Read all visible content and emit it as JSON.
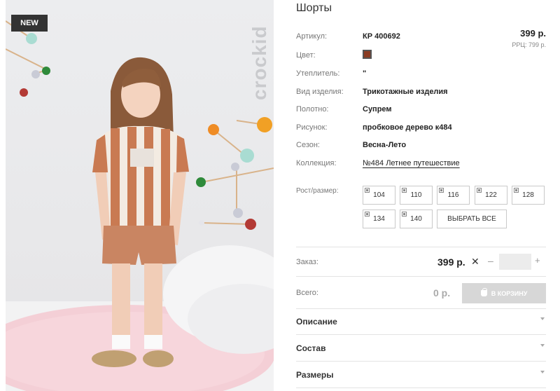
{
  "image": {
    "badge": "NEW",
    "brand": "crockid"
  },
  "product": {
    "title": "Шорты",
    "price": "399 р.",
    "rrp": "РРЦ: 799 р.",
    "color_hex": "#8a3b22",
    "attributes": [
      {
        "label": "Артикул:",
        "value": "КР 400692"
      },
      {
        "label": "Цвет:",
        "value": ""
      },
      {
        "label": "Утеплитель:",
        "value": "\""
      },
      {
        "label": "Вид изделия:",
        "value": "Трикотажные изделия"
      },
      {
        "label": "Полотно:",
        "value": "Супрем"
      },
      {
        "label": "Рисунок:",
        "value": "пробковое дерево к484"
      },
      {
        "label": "Сезон:",
        "value": "Весна-Лето"
      },
      {
        "label": "Коллекция:",
        "value": "№484 Летнее путешествие"
      }
    ]
  },
  "sizes": {
    "label": "Рост/размер:",
    "options": [
      "104",
      "110",
      "116",
      "122",
      "128",
      "134",
      "140"
    ],
    "select_all": "ВЫБРАТЬ ВСЕ"
  },
  "order": {
    "label": "Заказ:",
    "price": "399 р.",
    "times": "✕",
    "minus": "–",
    "plus": "+",
    "quantity": ""
  },
  "total": {
    "label": "Всего:",
    "value": "0 р.",
    "cart_button": "В КОРЗИНУ"
  },
  "accordion": [
    {
      "label": "Описание"
    },
    {
      "label": "Состав"
    },
    {
      "label": "Размеры"
    }
  ]
}
